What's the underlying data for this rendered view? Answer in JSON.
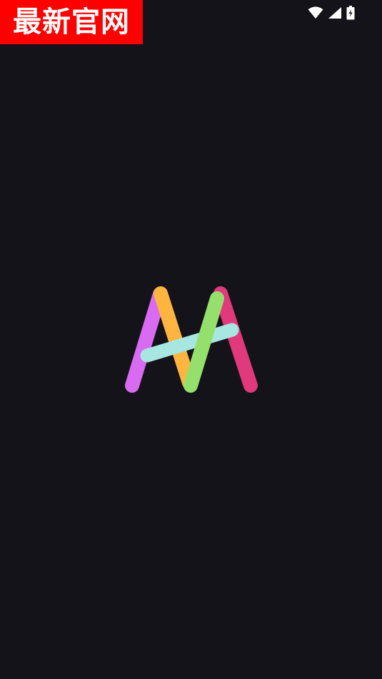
{
  "watermark": {
    "text": "最新官网",
    "background": "#ff0000",
    "color": "#ffffff"
  },
  "status_bar": {
    "icons": [
      "wifi-icon",
      "cell-signal-icon",
      "battery-charging-icon"
    ]
  },
  "splash": {
    "background": "#15131a",
    "logo": {
      "icon": "app-logo-icon",
      "stroke_colors": [
        "#d96bf2",
        "#ffb53f",
        "#a8e6e2",
        "#95e06c",
        "#e03a7c"
      ]
    }
  }
}
